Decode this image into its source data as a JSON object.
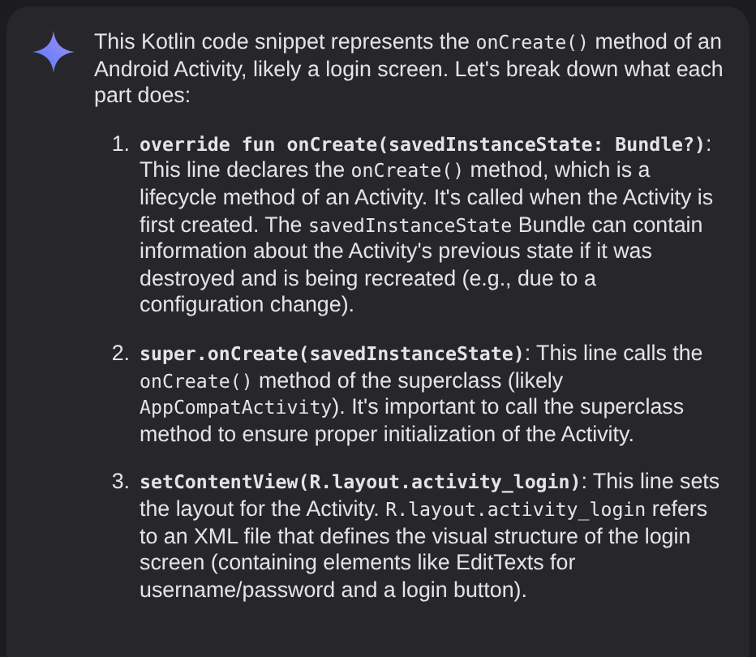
{
  "message": {
    "intro": [
      {
        "kind": "plain",
        "text": "This Kotlin code snippet represents the "
      },
      {
        "kind": "code",
        "text": "onCreate()"
      },
      {
        "kind": "plain",
        "text": " method of an Android Activity, likely a login screen. Let's break down what each part does:"
      }
    ],
    "items": [
      {
        "number": "1.",
        "segments": [
          {
            "kind": "code_bold",
            "text": "override fun onCreate(savedInstanceState: Bundle?)"
          },
          {
            "kind": "plain",
            "text": ": This line declares the "
          },
          {
            "kind": "code",
            "text": "onCreate()"
          },
          {
            "kind": "plain",
            "text": " method, which is a lifecycle method of an Activity. It's called when the Activity is first created. The "
          },
          {
            "kind": "code",
            "text": "savedInstanceState"
          },
          {
            "kind": "plain",
            "text": " Bundle can contain information about the Activity's previous state if it was destroyed and is being recreated (e.g., due to a configuration change)."
          }
        ]
      },
      {
        "number": "2.",
        "segments": [
          {
            "kind": "code_bold",
            "text": "super.onCreate(savedInstanceState)"
          },
          {
            "kind": "plain",
            "text": ": This line calls the "
          },
          {
            "kind": "code",
            "text": "onCreate()"
          },
          {
            "kind": "plain",
            "text": " method of the superclass (likely "
          },
          {
            "kind": "code",
            "text": "AppCompatActivity"
          },
          {
            "kind": "plain",
            "text": "). It's important to call the superclass method to ensure proper initialization of the Activity."
          }
        ]
      },
      {
        "number": "3.",
        "segments": [
          {
            "kind": "code_bold",
            "text": "setContentView(R.layout.activity_login)"
          },
          {
            "kind": "plain",
            "text": ": This line sets the layout for the Activity. "
          },
          {
            "kind": "code",
            "text": "R.layout.activity_login"
          },
          {
            "kind": "plain",
            "text": " refers to an XML file that defines the visual structure of the login screen (containing elements like EditTexts for username/password and a login button)."
          }
        ]
      }
    ]
  }
}
